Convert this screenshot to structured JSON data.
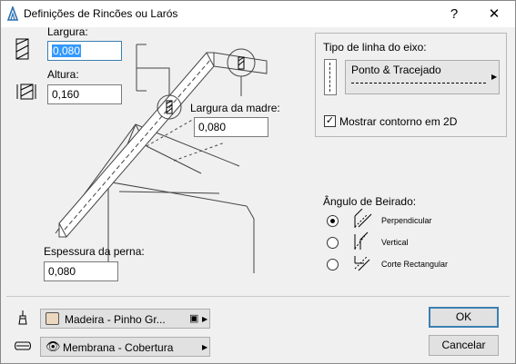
{
  "window": {
    "title": "Definições de Rincões ou Larós",
    "help": "?",
    "close": "✕"
  },
  "left": {
    "largura_label": "Largura:",
    "largura_value": "0,080",
    "altura_label": "Altura:",
    "altura_value": "0,160",
    "madre_label": "Largura da madre:",
    "madre_value": "0,080",
    "perna_label": "Espessura da perna:",
    "perna_value": "0,080"
  },
  "linetype": {
    "group_label": "Tipo de linha do eixo:",
    "selected": "Ponto & Tracejado",
    "show_contour_label": "Mostrar contorno em 2D",
    "show_contour_checked": true
  },
  "eaves": {
    "label": "Ângulo de Beirado:",
    "options": [
      "Perpendicular",
      "Vertical",
      "Corte Rectangular"
    ],
    "selected_index": 0
  },
  "bottom": {
    "material": "Madeira - Pinho Gr...",
    "composite": "Membrana - Cobertura",
    "ok": "OK",
    "cancel": "Cancelar"
  }
}
